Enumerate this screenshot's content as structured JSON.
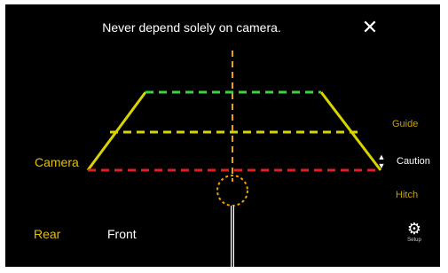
{
  "header": {
    "warning_text": "Never depend solely on camera."
  },
  "overlay": {
    "camera_label": "Camera",
    "guide_label": "Guide",
    "caution_label": "Caution",
    "hitch_label": "Hitch"
  },
  "footer": {
    "rear_label": "Rear",
    "front_label": "Front",
    "settings_sublabel": "Setup"
  },
  "icons": {
    "close": "close-icon",
    "settings": "gear-icon",
    "adjust": "up-down-arrow-icon"
  },
  "colors": {
    "background": "#000000",
    "guide_side": "#d9d400",
    "guide_far": "#3fd23f",
    "guide_mid": "#d9d400",
    "guide_near": "#e02020",
    "center_line": "#f0a000",
    "hitch_ring": "#f0a000",
    "label_yellow": "#e5c200"
  }
}
